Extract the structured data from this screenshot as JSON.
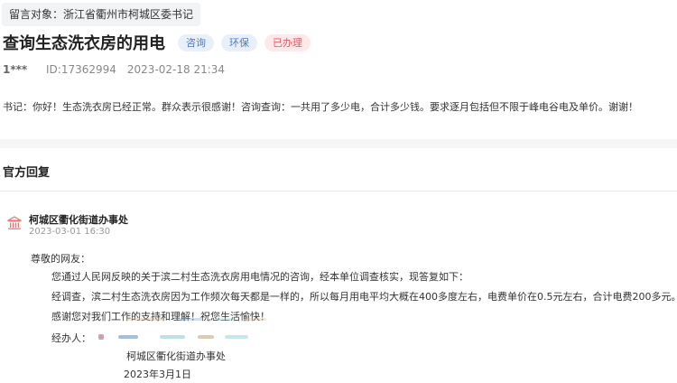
{
  "target": {
    "label": "留言对象：",
    "value": "浙江省衢州市柯城区委书记"
  },
  "post": {
    "title": "查询生态洗衣房的用电",
    "tags": [
      "咨询",
      "环保",
      "已办理"
    ],
    "user": "1***",
    "id": "ID:17362994",
    "time": "2023-02-18 21:34",
    "content": "书记：你好！生态洗衣房已经正常。群众表示很感谢！咨询查询：一共用了多少电，合计多少钱。要求逐月包括但不限于峰电谷电及单价。谢谢！"
  },
  "reply": {
    "section_title": "官方回复",
    "org_icon": "government-building-icon",
    "org_name": "柯城区衢化街道办事处",
    "time": "2023-03-01 16:30",
    "greeting": "尊敬的网友：",
    "paragraphs": [
      "您通过人民网反映的关于滨二村生态洗衣房用电情况的咨询，经本单位调查核实，现答复如下：",
      "经调查，滨二村生态洗衣房因为工作频次每天都是一样的，所以每月用电平均大概在400多度左右，电费单价在0.5元左右，合计电费200多元。",
      "感谢您对我们工作的支持和理解！祝您生活愉快！"
    ],
    "handler_label": "经办人：",
    "signature_org": "柯城区衢化街道办事处",
    "signature_date": "2023年3月1日"
  },
  "colors": {
    "tag_blue_bg": "#eaf0fa",
    "tag_blue_text": "#4a7bc4",
    "tag_red_bg": "#fde9ea",
    "tag_red_text": "#e05a60",
    "org_icon_color": "#e07a7a"
  }
}
